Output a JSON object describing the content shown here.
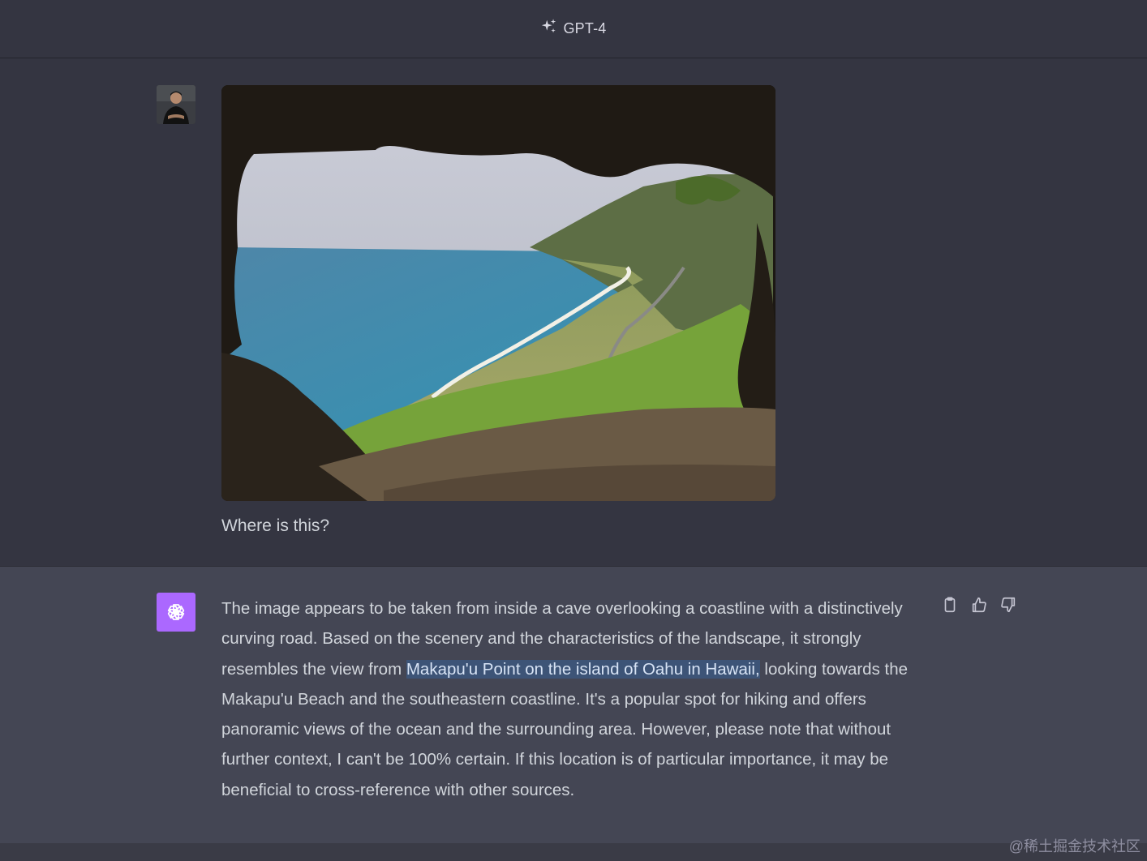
{
  "header": {
    "model_label": "GPT-4",
    "icon": "sparkle-icon"
  },
  "user_message": {
    "avatar": "user-avatar",
    "image": "cave-coastline-photo",
    "text": "Where is this?"
  },
  "assistant_message": {
    "avatar": "openai-logo-icon",
    "text_before": "The image appears to be taken from inside a cave overlooking a coastline with a distinctively curving road. Based on the scenery and the characteristics of the landscape, it strongly resembles the view from ",
    "text_highlight": "Makapu'u Point on the island of Oahu in Hawaii,",
    "text_after": " looking towards the Makapu'u Beach and the southeastern coastline. It's a popular spot for hiking and offers panoramic views of the ocean and the surrounding area. However, please note that without further context, I can't be 100% certain. If this location is of particular importance, it may be beneficial to cross-reference with other sources.",
    "actions": [
      "clipboard-icon",
      "thumbs-up-icon",
      "thumbs-down-icon"
    ]
  },
  "watermark": "@稀土掘金技术社区",
  "colors": {
    "background": "#343541",
    "assistant_background": "#444654",
    "gpt_avatar": "#ab68ff",
    "highlight": "#3d5477"
  }
}
